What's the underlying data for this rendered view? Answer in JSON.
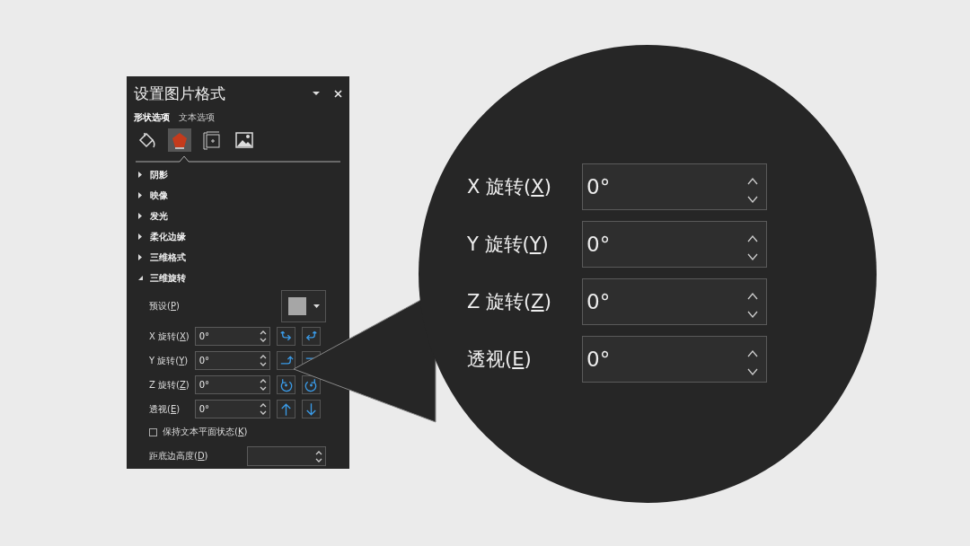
{
  "pane": {
    "title": "设置图片格式",
    "tabs": [
      {
        "label": "形状选项",
        "selected": true
      },
      {
        "label": "文本选项",
        "selected": false
      }
    ],
    "category_icons": [
      {
        "kind": "fill",
        "selected": false
      },
      {
        "kind": "effects",
        "selected": true
      },
      {
        "kind": "size",
        "selected": false
      },
      {
        "kind": "picture",
        "selected": false
      }
    ],
    "sections": [
      {
        "label": "阴影",
        "expanded": false
      },
      {
        "label": "映像",
        "expanded": false
      },
      {
        "label": "发光",
        "expanded": false
      },
      {
        "label": "柔化边缘",
        "expanded": false
      },
      {
        "label": "三维格式",
        "expanded": false
      },
      {
        "label": "三维旋转",
        "expanded": true
      }
    ],
    "preset": {
      "label": {
        "before": "预设(",
        "key": "P",
        "after": ")"
      }
    },
    "rotations": [
      {
        "label": {
          "before": "X 旋转(",
          "key": "X",
          "after": ")"
        },
        "value": "0°",
        "kind": "x"
      },
      {
        "label": {
          "before": "Y 旋转(",
          "key": "Y",
          "after": ")"
        },
        "value": "0°",
        "kind": "y"
      },
      {
        "label": {
          "before": "Z 旋转(",
          "key": "Z",
          "after": ")"
        },
        "value": "0°",
        "kind": "z"
      },
      {
        "label": {
          "before": "透视(",
          "key": "E",
          "after": ")"
        },
        "value": "0°",
        "kind": "perspective"
      }
    ],
    "keep_text_flat": {
      "label": {
        "before": "保持文本平面状态(",
        "key": "K",
        "after": ")"
      },
      "checked": false
    },
    "distance": {
      "label": {
        "before": "距底边高度(",
        "key": "D",
        "after": ")"
      }
    }
  },
  "magnifier": {
    "rows": [
      {
        "label": {
          "before": "X 旋转(",
          "key": "X",
          "after": ")"
        },
        "value": "0°"
      },
      {
        "label": {
          "before": "Y 旋转(",
          "key": "Y",
          "after": ")"
        },
        "value": "0°"
      },
      {
        "label": {
          "before": "Z 旋转(",
          "key": "Z",
          "after": ")"
        },
        "value": "0°"
      },
      {
        "label": {
          "before": "透视(",
          "key": "E",
          "after": ")"
        },
        "value": "0°"
      }
    ]
  }
}
